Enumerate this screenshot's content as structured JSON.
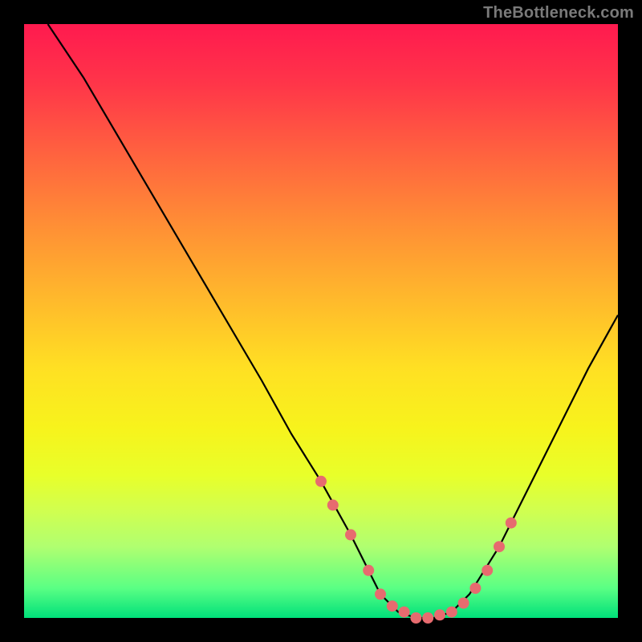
{
  "watermark": "TheBottleneck.com",
  "chart_data": {
    "type": "line",
    "title": "",
    "xlabel": "",
    "ylabel": "",
    "xlim": [
      0,
      100
    ],
    "ylim": [
      0,
      100
    ],
    "grid": false,
    "legend": false,
    "series": [
      {
        "name": "bottleneck-curve",
        "color": "#000000",
        "x": [
          4,
          10,
          20,
          30,
          40,
          45,
          50,
          55,
          58,
          60,
          63,
          66,
          69,
          72,
          75,
          80,
          85,
          90,
          95,
          100
        ],
        "y": [
          100,
          91,
          74,
          57,
          40,
          31,
          23,
          14,
          8,
          4,
          1,
          0,
          0,
          1,
          4,
          12,
          22,
          32,
          42,
          51
        ]
      }
    ],
    "markers": {
      "name": "highlight-dots",
      "color": "#e76b6f",
      "radius_px": 7,
      "x": [
        50,
        52,
        55,
        58,
        60,
        62,
        64,
        66,
        68,
        70,
        72,
        74,
        76,
        78,
        80,
        82
      ],
      "y": [
        23,
        19,
        14,
        8,
        4,
        2,
        1,
        0,
        0,
        0.5,
        1,
        2.5,
        5,
        8,
        12,
        16
      ]
    },
    "background_gradient": {
      "top": "#ff1a4f",
      "mid": "#ffe023",
      "bottom": "#00e07a"
    },
    "frame_color": "#000000"
  }
}
